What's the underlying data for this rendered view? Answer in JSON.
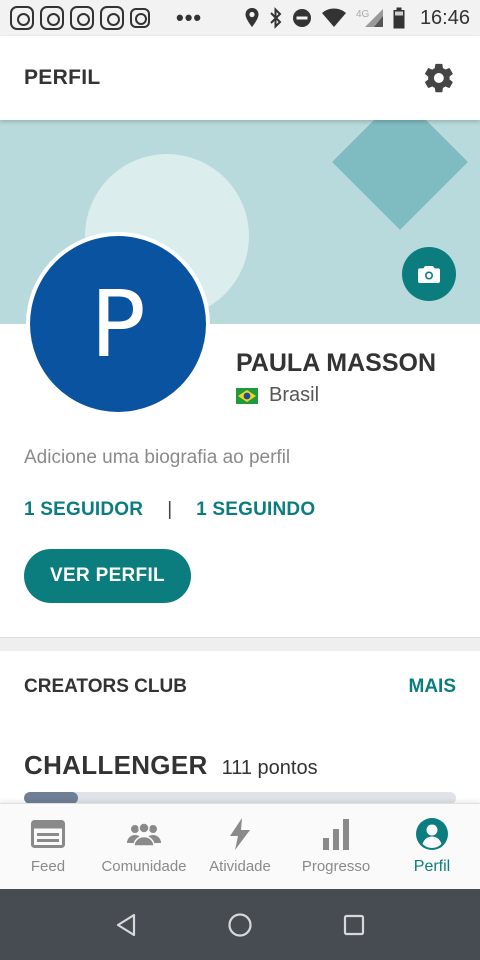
{
  "status_bar": {
    "time": "16:46",
    "network": "4G"
  },
  "header": {
    "title": "PERFIL"
  },
  "profile": {
    "avatar_letter": "P",
    "name": "PAULA MASSON",
    "country": "Brasil",
    "bio_placeholder": "Adicione uma biografia ao perfil",
    "followers_label": "1 SEGUIDOR",
    "separator": "|",
    "following_label": "1 SEGUINDO",
    "view_profile_label": "VER PERFIL"
  },
  "creators_club": {
    "title": "CREATORS CLUB",
    "more_label": "MAIS",
    "level": "CHALLENGER",
    "points": "111 pontos",
    "progress_fraction": 0.125
  },
  "bottom_nav": [
    {
      "label": "Feed",
      "icon": "feed-icon",
      "active": false
    },
    {
      "label": "Comunidade",
      "icon": "community-icon",
      "active": false
    },
    {
      "label": "Atividade",
      "icon": "lightning-icon",
      "active": false
    },
    {
      "label": "Progresso",
      "icon": "bar-chart-icon",
      "active": false
    },
    {
      "label": "Perfil",
      "icon": "person-icon",
      "active": true
    }
  ],
  "colors": {
    "accent": "#0b7d7f",
    "avatar": "#0a53a0",
    "cover": "#b9dadc"
  }
}
